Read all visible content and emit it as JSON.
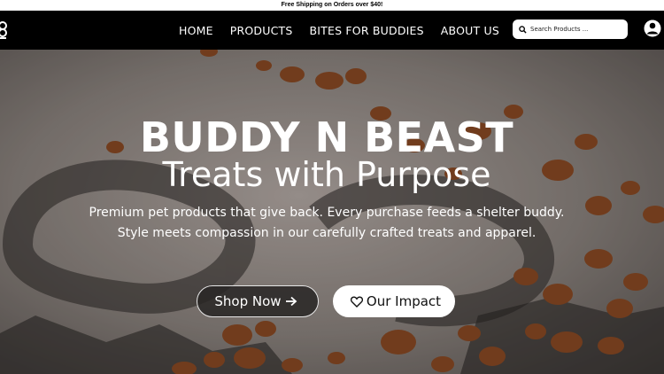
{
  "promo": {
    "text": "Free Shipping on Orders over $40!"
  },
  "nav": {
    "items": [
      {
        "label": "HOME"
      },
      {
        "label": "PRODUCTS"
      },
      {
        "label": "BITES FOR BUDDIES"
      },
      {
        "label": "ABOUT US"
      }
    ],
    "search": {
      "placeholder": "Search Products ...",
      "icon": "search-icon"
    },
    "account_icon": "account-icon"
  },
  "hero": {
    "title": "BUDDY N BEAST",
    "subtitle": "Treats with Purpose",
    "line1": "Premium pet products that give back. Every purchase feeds a shelter buddy.",
    "line2": "Style meets compassion in our carefully crafted treats and apparel.",
    "shop_button": "Shop Now",
    "shop_icon": "arrow-right-icon",
    "impact_button": "Our Impact",
    "impact_icon": "heart-icon"
  },
  "colors": {
    "nav_bg": "#000000",
    "promo_bg": "#ffffff",
    "kibble": "#8a4a24"
  }
}
